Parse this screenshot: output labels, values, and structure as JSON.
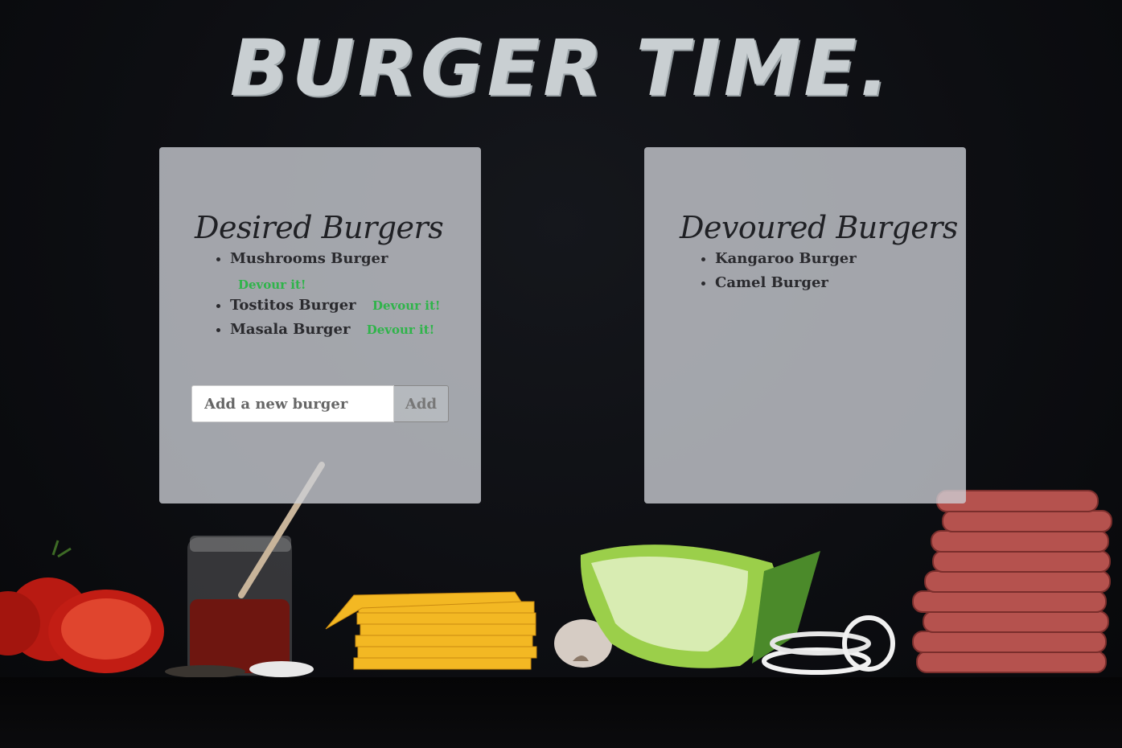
{
  "header": {
    "title": "BURGER TIME."
  },
  "desired": {
    "heading": "Desired Burgers",
    "items": [
      {
        "name": "Mushrooms Burger",
        "action": "Devour it!"
      },
      {
        "name": "Tostitos Burger",
        "action": "Devour it!"
      },
      {
        "name": "Masala Burger",
        "action": "Devour it!"
      }
    ],
    "form": {
      "placeholder": "Add a new burger",
      "button_label": "Add"
    }
  },
  "devoured": {
    "heading": "Devoured Burgers",
    "items": [
      "Kangaroo Burger",
      "Camel Burger"
    ]
  },
  "colors": {
    "background": "#0d0e12",
    "panel": "#cdd0d6",
    "accent": "#2fb44a",
    "title": "#c9cfd2"
  },
  "background_image": "burger-ingredients-photo"
}
